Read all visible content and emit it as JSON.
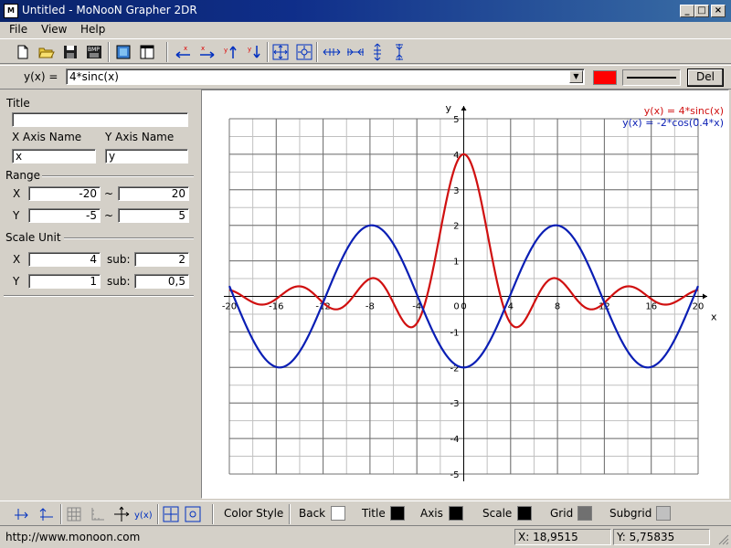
{
  "window": {
    "title": "Untitled - MoNooN Grapher 2DR"
  },
  "menu": {
    "items": [
      "File",
      "View",
      "Help"
    ]
  },
  "function_bar": {
    "label": "y(x) =",
    "expression": "4*sinc(x)",
    "color": "#ff0000",
    "del_label": "Del"
  },
  "panel": {
    "title_label": "Title",
    "title_value": "",
    "x_axis_name_label": "X Axis Name",
    "y_axis_name_label": "Y Axis Name",
    "x_axis_name_value": "x",
    "y_axis_name_value": "y",
    "range_label": "Range",
    "range_x_label": "X",
    "range_y_label": "Y",
    "tilde": "~",
    "range_x_min": "-20",
    "range_x_max": "20",
    "range_y_min": "-5",
    "range_y_max": "5",
    "scale_unit_label": "Scale Unit",
    "scale_x_label": "X",
    "scale_y_label": "Y",
    "sub_label": "sub:",
    "scale_x_value": "4",
    "scale_x_sub": "2",
    "scale_y_value": "1",
    "scale_y_sub": "0,5"
  },
  "bottom_bar": {
    "color_style_label": "Color Style",
    "back_label": "Back",
    "title_label": "Title",
    "axis_label": "Axis",
    "scale_label": "Scale",
    "grid_label": "Grid",
    "subgrid_label": "Subgrid",
    "colors": {
      "back": "#ffffff",
      "title": "#000000",
      "axis": "#000000",
      "scale": "#000000",
      "grid": "#707070",
      "subgrid": "#c0c0c0"
    }
  },
  "status": {
    "url": "http://www.monoon.com",
    "x_coord": "X: 18,9515",
    "y_coord": "Y: 5,75835"
  },
  "chart_data": {
    "type": "line",
    "xlabel": "x",
    "ylabel": "y",
    "xlim": [
      -20,
      20
    ],
    "ylim": [
      -5,
      5
    ],
    "x_major_step": 4,
    "x_minor_step": 2,
    "y_major_step": 1,
    "y_minor_step": 0.5,
    "x_ticks": [
      "-20",
      "-16",
      "-12",
      "-8",
      "-4",
      "0",
      "4",
      "8",
      "12",
      "16",
      "20"
    ],
    "y_ticks": [
      "5",
      "4",
      "3",
      "2",
      "1",
      "-1",
      "-2",
      "-3",
      "-4",
      "-5"
    ],
    "grid": true,
    "legend_position": "top-right",
    "series": [
      {
        "name": "y(x) = 4*sinc(x)",
        "color": "#d01010",
        "function": "4*sinc(x)"
      },
      {
        "name": "y(x) = -2*cos(0.4*x)",
        "color": "#0a1eb4",
        "function": "-2*cos(0.4*x)"
      }
    ]
  }
}
